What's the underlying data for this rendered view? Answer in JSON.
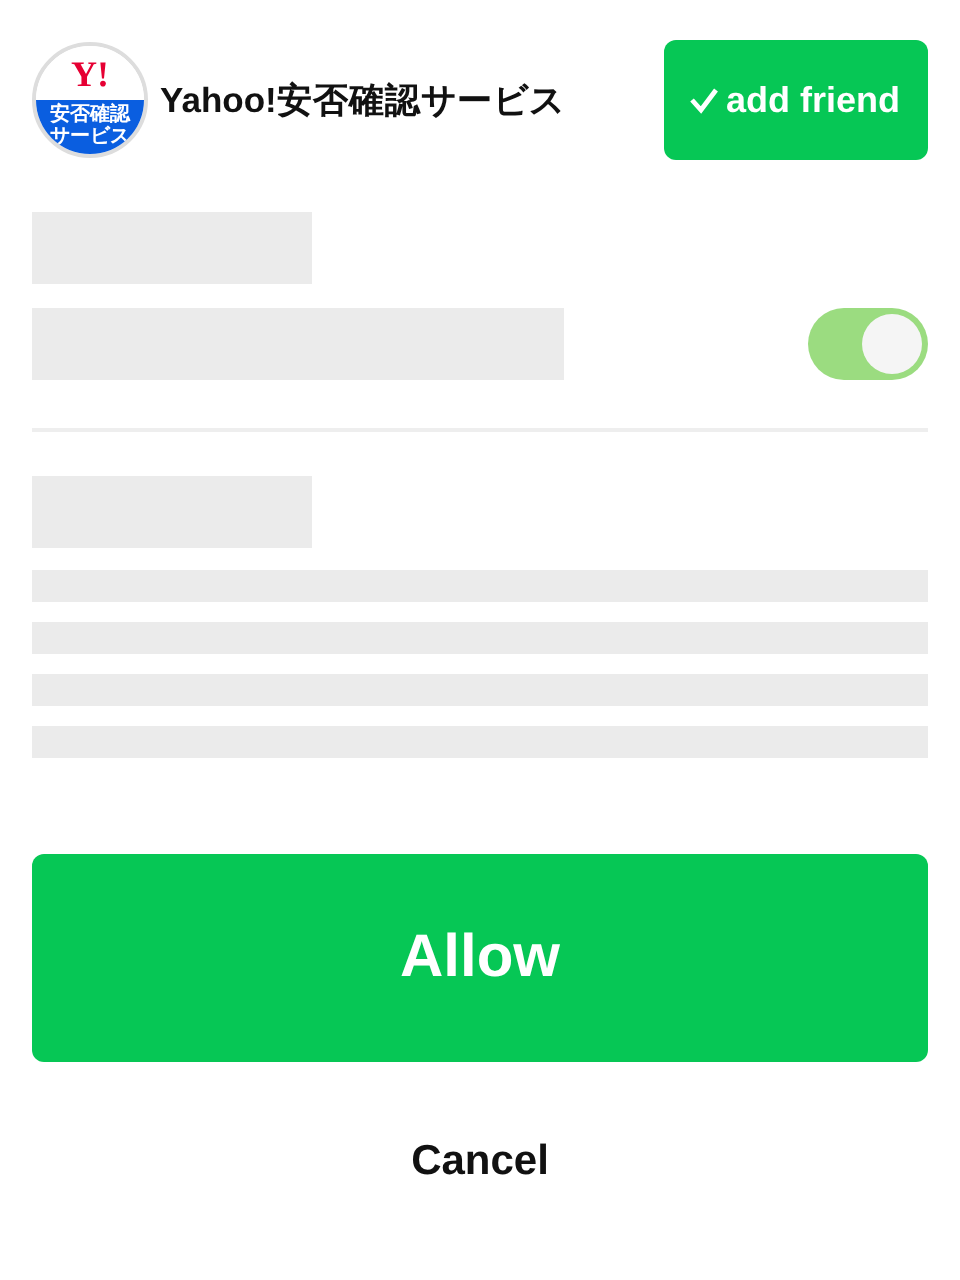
{
  "header": {
    "logo": {
      "mark": "Y!",
      "lines": [
        "安否確認",
        "サービス"
      ]
    },
    "title": "Yahoo!安否確認サービス",
    "friend_button": {
      "label": "add friend",
      "added": true
    }
  },
  "permission": {
    "toggle": {
      "on": true
    }
  },
  "actions": {
    "primary": "Allow",
    "secondary": "Cancel"
  }
}
